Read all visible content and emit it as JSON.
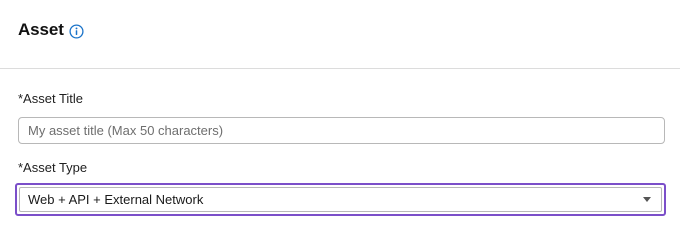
{
  "header": {
    "title": "Asset",
    "info_icon": "info-circle-icon",
    "info_icon_color": "#1a73c9"
  },
  "form": {
    "asset_title": {
      "label": "*Asset Title",
      "value": "",
      "placeholder": "My asset title (Max 50 characters)"
    },
    "asset_type": {
      "label": "*Asset Type",
      "selected": "Web + API + External Network",
      "focus_color": "#7b4fc9",
      "dropdown_icon": "chevron-down-icon"
    }
  }
}
